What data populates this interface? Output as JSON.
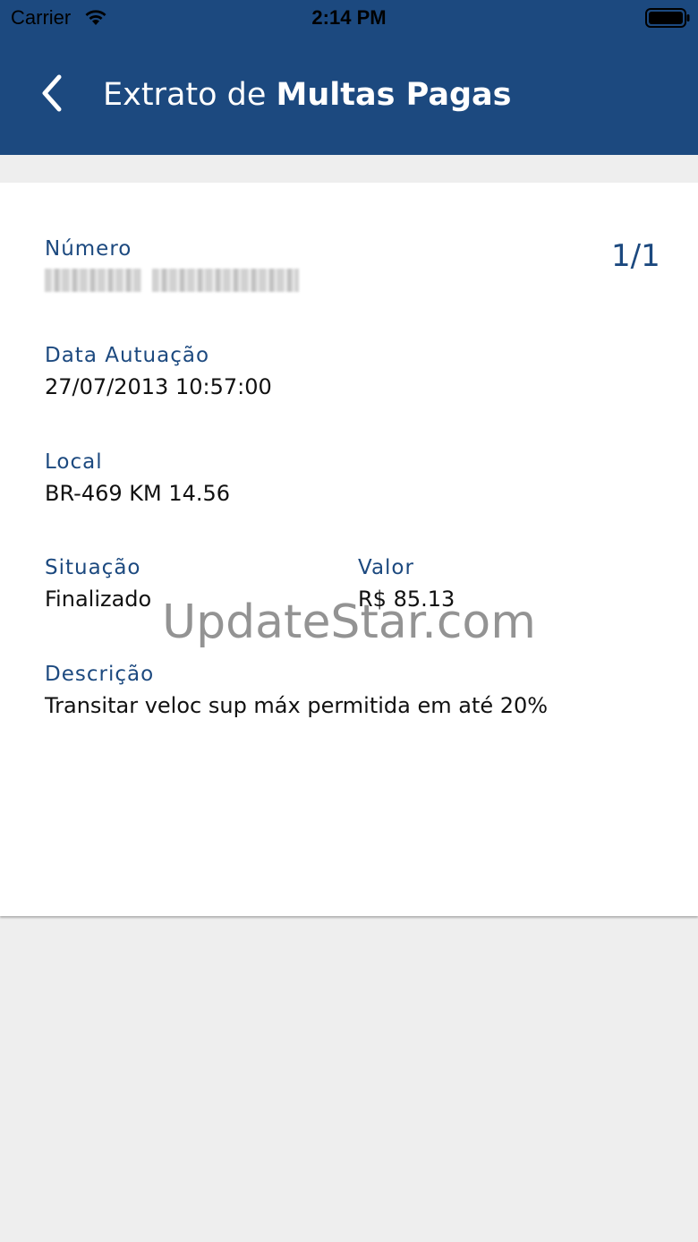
{
  "status_bar": {
    "carrier": "Carrier",
    "time": "2:14 PM",
    "wifi_icon": "wifi-icon",
    "battery_icon": "battery-icon"
  },
  "header": {
    "back_icon": "chevron-left-icon",
    "title_prefix": "Extrato de ",
    "title_bold": "Multas Pagas",
    "background_color": "#1c497f"
  },
  "fine": {
    "numero_label": "Número",
    "numero_value_redacted": true,
    "page_counter": "1/1",
    "data_label": "Data Autuação",
    "data_value": "27/07/2013 10:57:00",
    "local_label": "Local",
    "local_value": "BR-469 KM 14.56",
    "situacao_label": "Situação",
    "situacao_value": "Finalizado",
    "valor_label": "Valor",
    "valor_value": "R$ 85.13",
    "descricao_label": "Descrição",
    "descricao_value": "Transitar veloc sup máx permitida em até 20%"
  },
  "watermark": "UpdateStar.com",
  "colors": {
    "accent": "#1c497f",
    "page_background": "#eeeeee",
    "card_background": "#ffffff"
  }
}
